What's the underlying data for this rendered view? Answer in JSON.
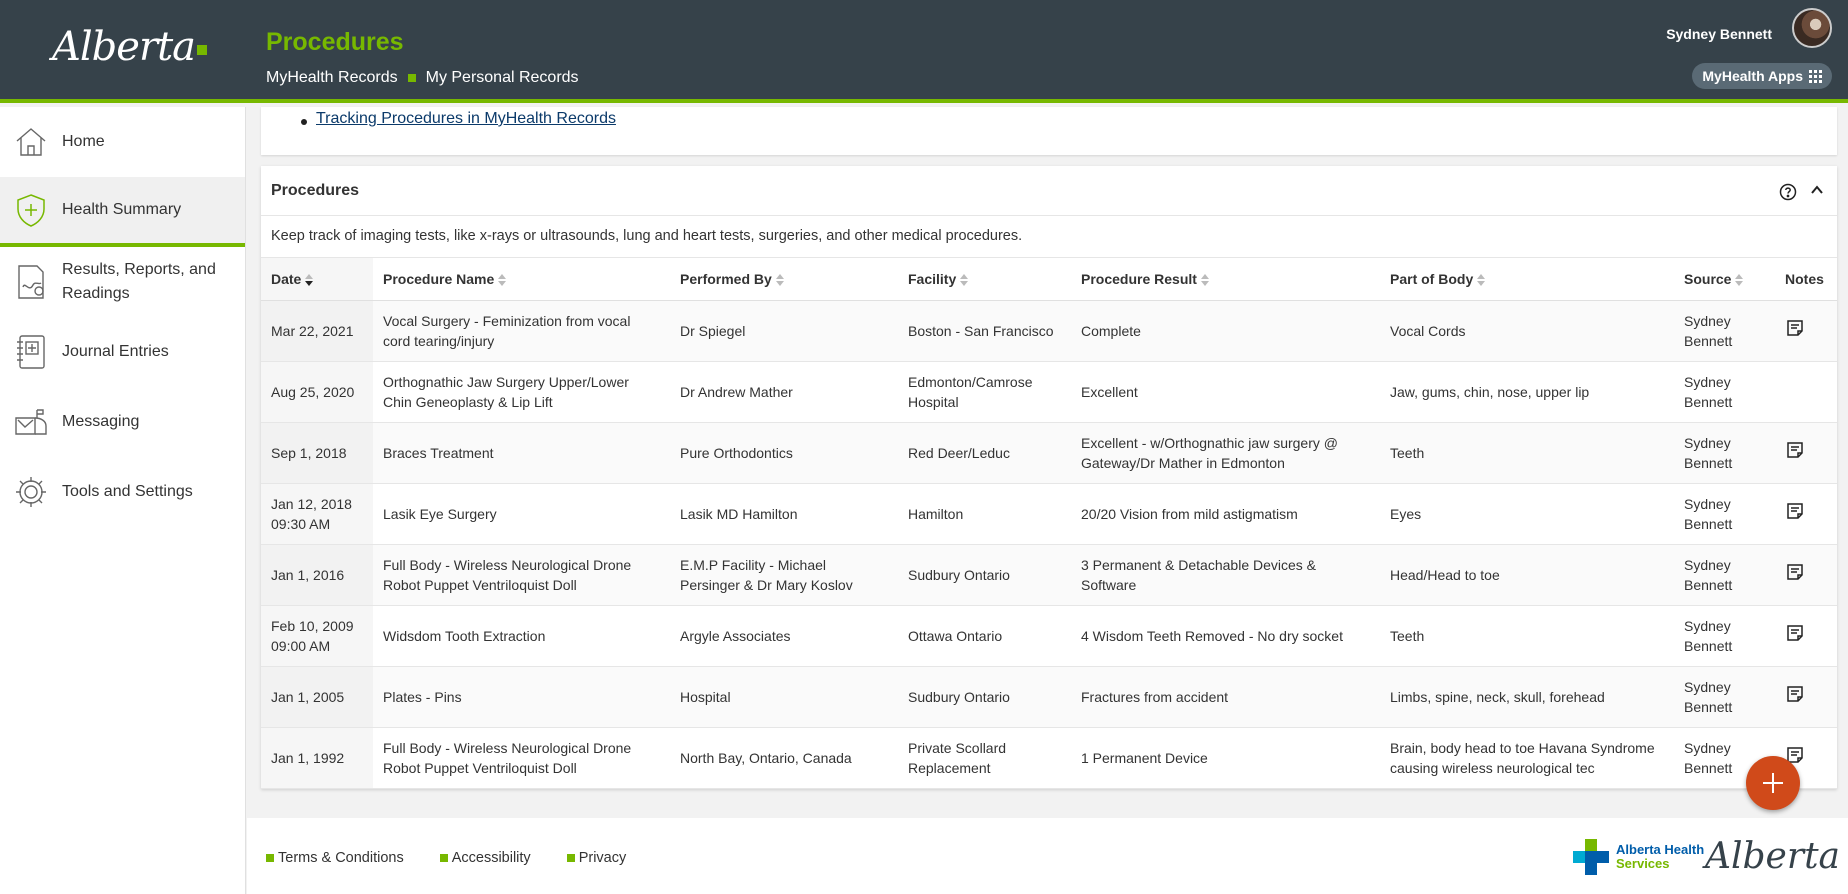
{
  "header": {
    "logo_text": "Alberta",
    "page_title": "Procedures",
    "breadcrumb_1": "MyHealth Records",
    "breadcrumb_2": "My Personal Records",
    "user_name": "Sydney Bennett",
    "apps_label": "MyHealth Apps",
    "accent_color": "#77b800",
    "bg_color": "#36424a"
  },
  "sidebar": {
    "items": [
      {
        "label": "Home",
        "icon": "home-icon"
      },
      {
        "label": "Health Summary",
        "icon": "shield-plus-icon"
      },
      {
        "label": "Results, Reports, and Readings",
        "icon": "report-icon"
      },
      {
        "label": "Journal Entries",
        "icon": "journal-icon"
      },
      {
        "label": "Messaging",
        "icon": "mailbox-icon"
      },
      {
        "label": "Tools and Settings",
        "icon": "gear-icon"
      }
    ]
  },
  "top_link": "Tracking Procedures in MyHealth Records",
  "card": {
    "title": "Procedures",
    "description": "Keep track of imaging tests, like x-rays or ultrasounds, lung and heart tests, surgeries, and other medical procedures.",
    "columns": [
      "Date",
      "Procedure Name",
      "Performed By",
      "Facility",
      "Procedure Result",
      "Part of Body",
      "Source",
      "Notes"
    ],
    "rows": [
      {
        "date": "Mar 22, 2021",
        "time": "",
        "name": "Vocal Surgery - Feminization from vocal cord tearing/injury",
        "by": "Dr Spiegel",
        "facility": "Boston - San Francisco",
        "result": "Complete",
        "body": "Vocal Cords",
        "source": "Sydney Bennett",
        "note": true
      },
      {
        "date": "Aug 25, 2020",
        "time": "",
        "name": "Orthognathic Jaw Surgery Upper/Lower Chin Geneoplasty & Lip Lift",
        "by": "Dr Andrew Mather",
        "facility": "Edmonton/Camrose Hospital",
        "result": "Excellent",
        "body": "Jaw, gums, chin, nose, upper lip",
        "source": "Sydney Bennett",
        "note": false
      },
      {
        "date": "Sep 1, 2018",
        "time": "",
        "name": "Braces Treatment",
        "by": "Pure Orthodontics",
        "facility": "Red Deer/Leduc",
        "result": "Excellent - w/Orthognathic jaw surgery @ Gateway/Dr Mather in Edmonton",
        "body": "Teeth",
        "source": "Sydney Bennett",
        "note": true
      },
      {
        "date": "Jan 12, 2018",
        "time": "09:30 AM",
        "name": "Lasik Eye Surgery",
        "by": "Lasik MD Hamilton",
        "facility": "Hamilton",
        "result": "20/20 Vision from mild astigmatism",
        "body": "Eyes",
        "source": "Sydney Bennett",
        "note": true
      },
      {
        "date": "Jan 1, 2016",
        "time": "",
        "name": "Full Body - Wireless Neurological Drone Robot Puppet Ventriloquist Doll",
        "by": "E.M.P Facility - Michael Persinger & Dr Mary Koslov",
        "facility": "Sudbury Ontario",
        "result": "3 Permanent & Detachable Devices & Software",
        "body": "Head/Head to toe",
        "source": "Sydney Bennett",
        "note": true
      },
      {
        "date": "Feb 10, 2009",
        "time": "09:00 AM",
        "name": "Widsdom Tooth Extraction",
        "by": "Argyle Associates",
        "facility": "Ottawa Ontario",
        "result": "4 Wisdom Teeth Removed - No dry socket",
        "body": "Teeth",
        "source": "Sydney Bennett",
        "note": true
      },
      {
        "date": "Jan 1, 2005",
        "time": "",
        "name": "Plates - Pins",
        "by": "Hospital",
        "facility": "Sudbury Ontario",
        "result": "Fractures from accident",
        "body": "Limbs, spine, neck, skull, forehead",
        "source": "Sydney Bennett",
        "note": true
      },
      {
        "date": "Jan 1, 1992",
        "time": "",
        "name": "Full Body - Wireless Neurological Drone Robot Puppet Ventriloquist Doll",
        "by": "North Bay, Ontario, Canada",
        "facility": "Private Scollard Replacement",
        "result": "1 Permanent Device",
        "body": "Brain, body head to toe Havana Syndrome causing wireless neurological tec",
        "source": "Sydney Bennett",
        "note": true
      }
    ]
  },
  "fab_color": "#d04a1a",
  "footer": {
    "links": [
      "Terms & Conditions",
      "Accessibility",
      "Privacy"
    ],
    "ahs_line1": "Alberta Health",
    "ahs_line2": "Services",
    "alberta_logo": "Alberta"
  }
}
